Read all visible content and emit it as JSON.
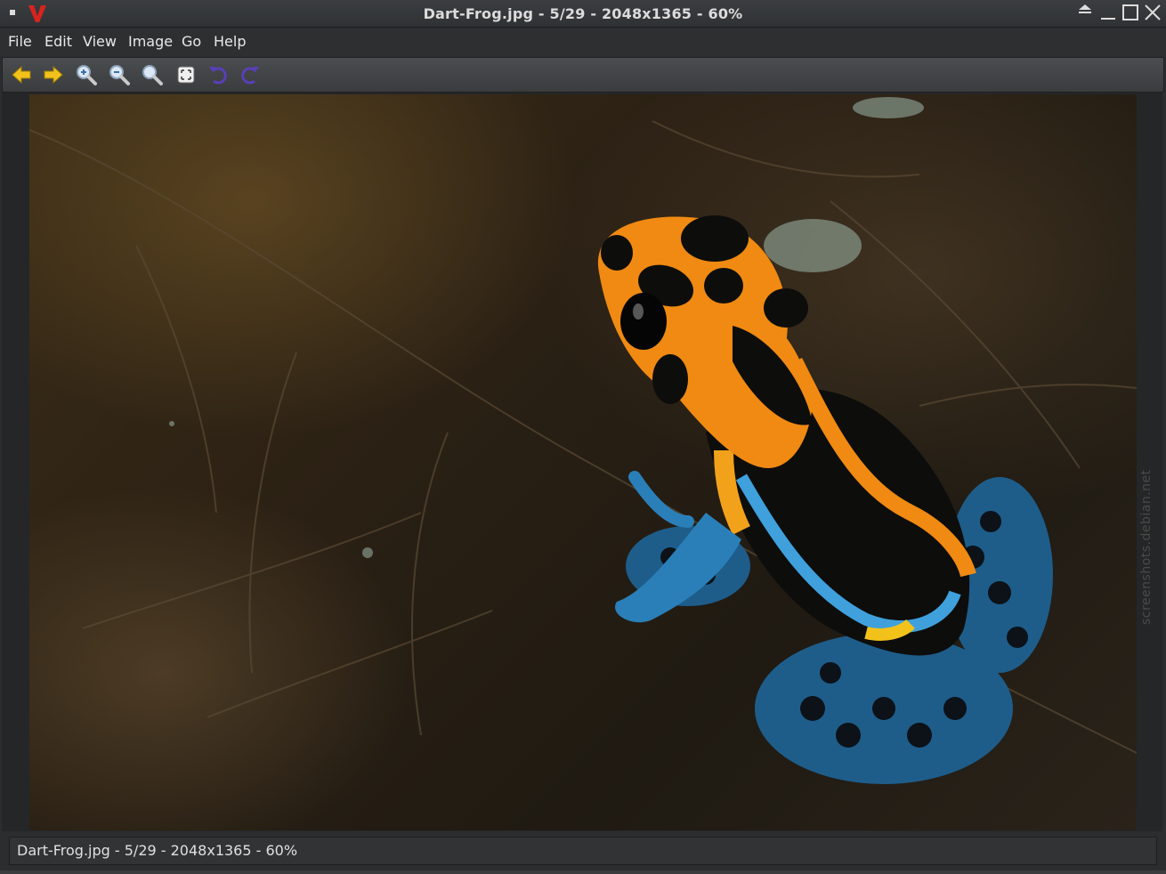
{
  "window": {
    "title": "Dart-Frog.jpg - 5/29 - 2048x1365 - 60%",
    "app_icon": "v-logo-icon",
    "controls": [
      "keep-above-icon",
      "minimize-icon",
      "maximize-icon",
      "close-icon"
    ]
  },
  "menubar": {
    "items": [
      {
        "label": "File"
      },
      {
        "label": "Edit"
      },
      {
        "label": "View"
      },
      {
        "label": "Image"
      },
      {
        "label": "Go"
      },
      {
        "label": "Help"
      }
    ]
  },
  "toolbar": {
    "buttons": [
      {
        "icon": "arrow-left-icon"
      },
      {
        "icon": "arrow-right-icon"
      },
      {
        "icon": "zoom-in-icon"
      },
      {
        "icon": "zoom-out-icon"
      },
      {
        "icon": "zoom-original-icon"
      },
      {
        "icon": "fit-to-window-icon"
      },
      {
        "icon": "rotate-left-icon"
      },
      {
        "icon": "rotate-right-icon"
      }
    ]
  },
  "image": {
    "subject": "dart frog photo"
  },
  "watermark": {
    "text": "screenshots.debian.net"
  },
  "statusbar": {
    "text": "Dart-Frog.jpg - 5/29 - 2048x1365 - 60%"
  },
  "colors": {
    "accent_yellow": "#f2c21b",
    "rotate_purple": "#5a3fb8",
    "frog_orange": "#f08a12",
    "frog_blue": "#3fa0dc"
  }
}
